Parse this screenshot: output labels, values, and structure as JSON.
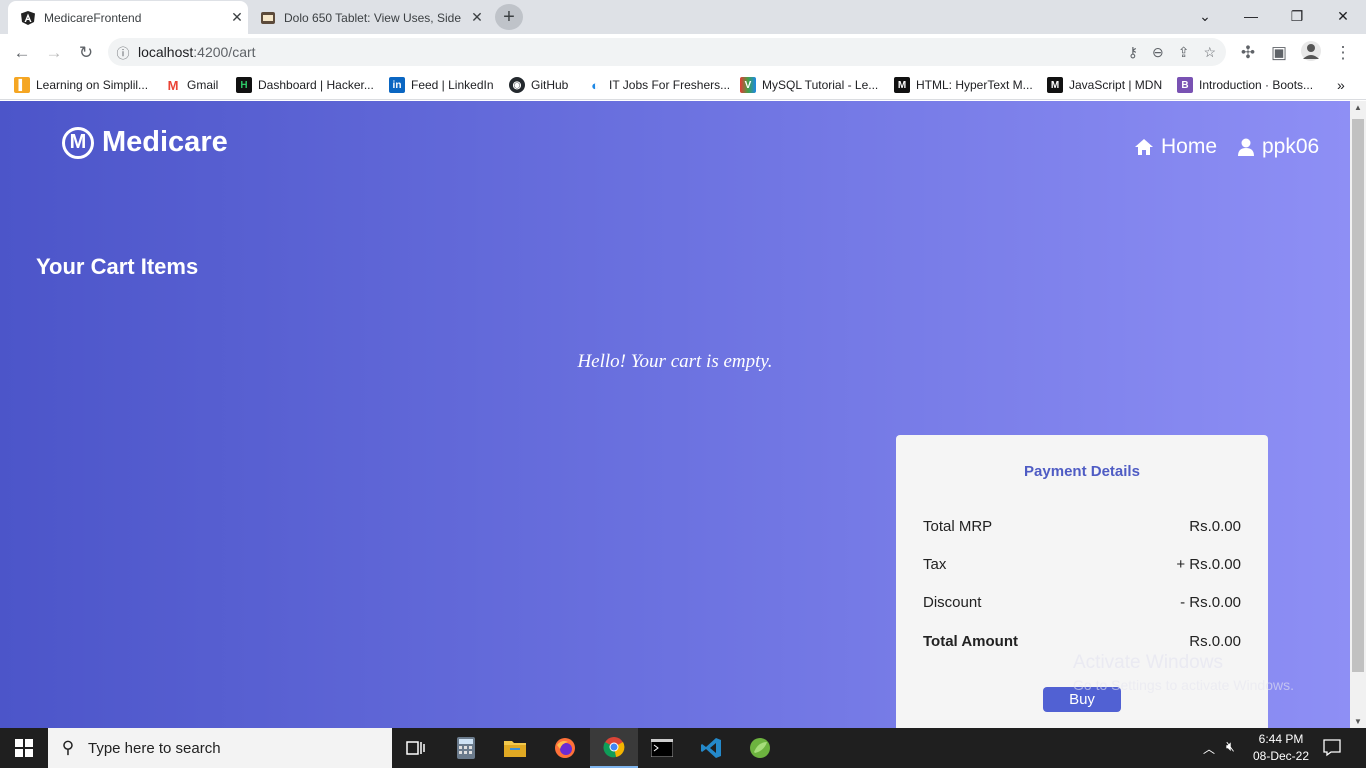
{
  "browser": {
    "tabs": [
      {
        "title": "MedicareFrontend",
        "active": true,
        "favicon": "angular-icon"
      },
      {
        "title": "Dolo 650 Tablet: View Uses, Side",
        "active": false,
        "favicon": "1mg-icon"
      }
    ],
    "url": {
      "host": "localhost",
      "rest": ":4200/cart"
    },
    "bookmarks": [
      {
        "label": "Learning on Simplil...",
        "icon": "simplilearn-icon",
        "color": "#f5a623"
      },
      {
        "label": "Gmail",
        "icon": "gmail-icon",
        "color": "#ea4335"
      },
      {
        "label": "Dashboard | Hacker...",
        "icon": "hackerrank-icon",
        "color": "#111111"
      },
      {
        "label": "Feed | LinkedIn",
        "icon": "linkedin-icon",
        "color": "#0a66c2"
      },
      {
        "label": "GitHub",
        "icon": "github-icon",
        "color": "#24292e"
      },
      {
        "label": "IT Jobs For Freshers...",
        "icon": "jobs-icon",
        "color": "#1e88e5"
      },
      {
        "label": "MySQL Tutorial - Le...",
        "icon": "mysql-icon",
        "color": "#e65100"
      },
      {
        "label": "HTML: HyperText M...",
        "icon": "mdn-icon",
        "color": "#111111"
      },
      {
        "label": "JavaScript | MDN",
        "icon": "mdn-icon",
        "color": "#111111"
      },
      {
        "label": "Introduction · Boots...",
        "icon": "bootstrap-icon",
        "color": "#7952b3"
      }
    ]
  },
  "app": {
    "brand": "Medicare",
    "brand_letter": "M",
    "nav": {
      "home": "Home",
      "user": "ppk06"
    },
    "cart_heading": "Your Cart Items",
    "empty_message": "Hello! Your cart is empty.",
    "payment": {
      "title": "Payment Details",
      "rows": [
        {
          "label": "Total MRP",
          "value": "Rs.0.00"
        },
        {
          "label": "Tax",
          "value": "+ Rs.0.00"
        },
        {
          "label": "Discount",
          "value": "- Rs.0.00"
        },
        {
          "label": "Total Amount",
          "value": "Rs.0.00"
        }
      ],
      "buy_label": "Buy"
    }
  },
  "watermark": {
    "line1": "Activate Windows",
    "line2": "Go to Settings to activate Windows."
  },
  "taskbar": {
    "search_placeholder": "Type here to search",
    "time": "6:44 PM",
    "date": "08-Dec-22"
  }
}
